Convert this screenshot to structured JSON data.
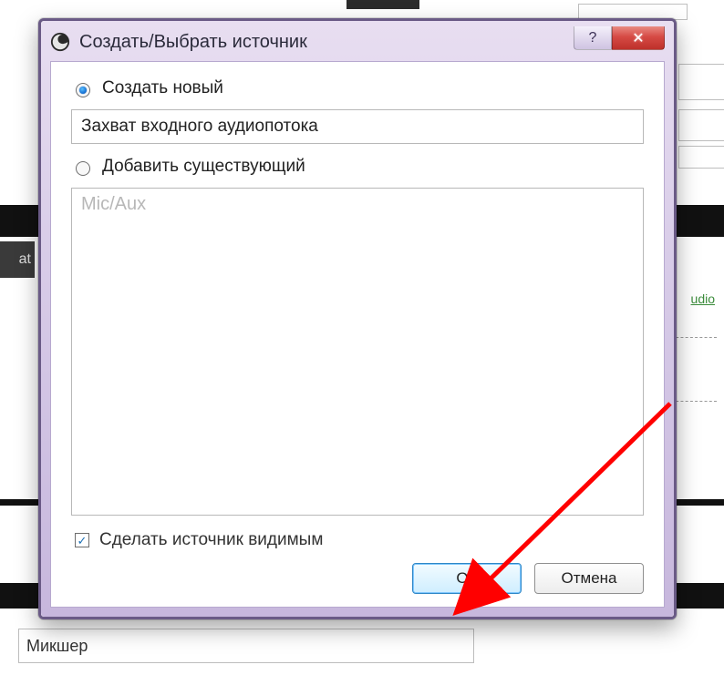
{
  "background": {
    "tab_fragment": "at",
    "green_link": "udio",
    "mixer_label": "Микшер"
  },
  "dialog": {
    "title": "Создать/Выбрать источник",
    "help_label": "?",
    "close_label": "✕",
    "create_new_label": "Создать новый",
    "input_value": "Захват входного аудиопотока",
    "add_existing_label": "Добавить существующий",
    "existing_items": [
      "Mic/Aux"
    ],
    "existing_first": "Mic/Aux",
    "visible_label": "Сделать источник видимым",
    "ok_label": "ОК",
    "cancel_label": "Отмена",
    "create_selected": true,
    "visible_checked": true
  }
}
